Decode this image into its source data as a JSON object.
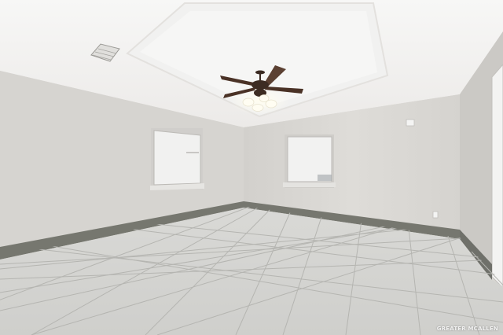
{
  "scene": {
    "subject": "empty-room-interior",
    "colors": {
      "ceiling": "#f4f4f3",
      "wall": "#d9d7d3",
      "wall_right": "#cfcdc9",
      "floor_tile": "#d6d6d3",
      "grout": "#b8b8b4",
      "baseboard": "#76776f",
      "fan_blade": "#4a3226",
      "light_glow": "#fffdf2"
    },
    "watermark": {
      "text": "GREATER MCALLEN"
    }
  }
}
